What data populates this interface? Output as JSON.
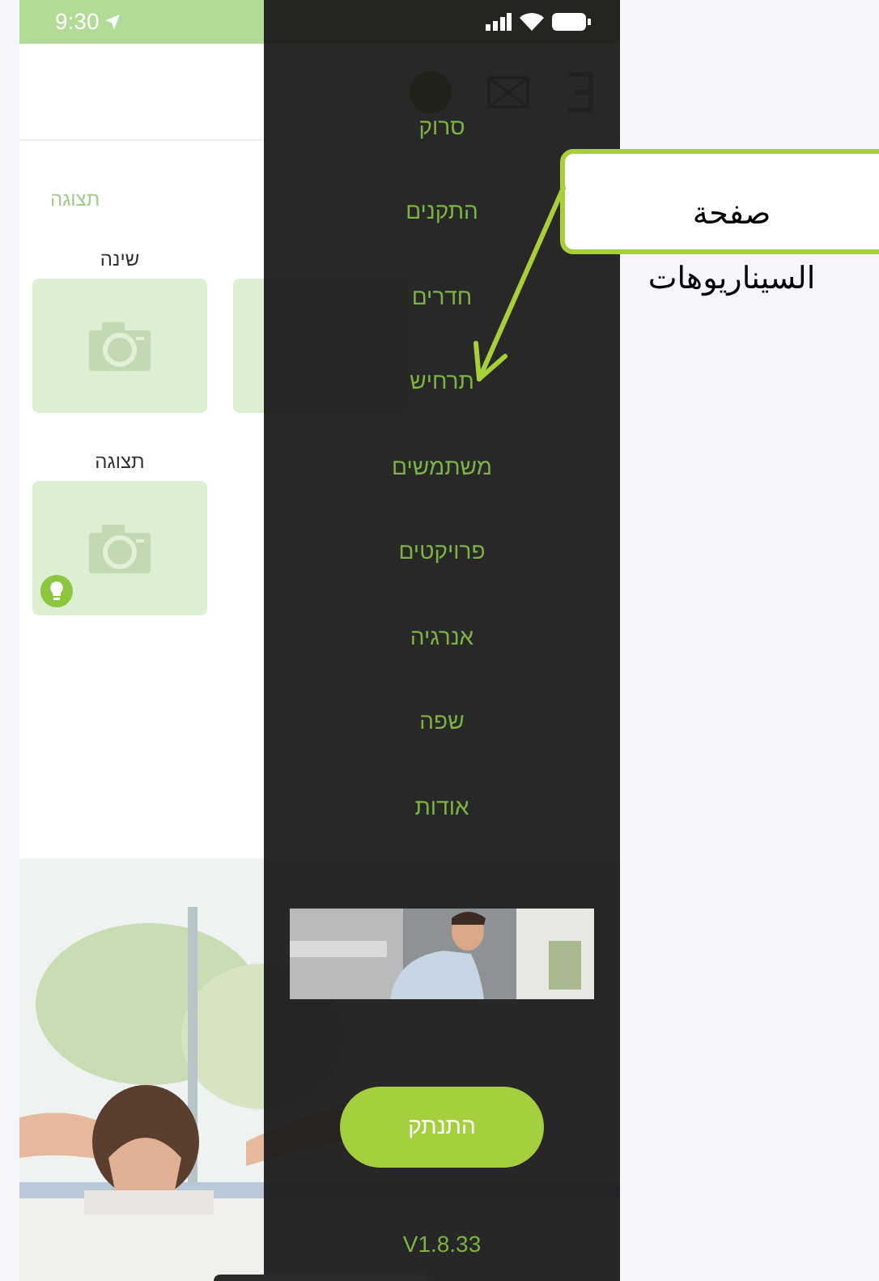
{
  "status_bar": {
    "time": "9:30"
  },
  "main_page": {
    "section_title": "תצוגה",
    "rooms": [
      {
        "kind": "covered"
      },
      {
        "kind": "room",
        "label": "שינה"
      }
    ],
    "second_section": {
      "title": "תצוגה",
      "rooms": [
        {
          "kind": "room",
          "has_light": true
        }
      ]
    }
  },
  "menu": {
    "items": [
      {
        "label": "סרוק",
        "selected": false
      },
      {
        "label": "התקנים",
        "selected": false
      },
      {
        "label": "חדרים",
        "selected": false
      },
      {
        "label": "תרחיש",
        "selected": false
      },
      {
        "label": "משתמשים",
        "selected": false
      },
      {
        "label": "פרויקטים",
        "selected": false
      },
      {
        "label": "אנרגיה",
        "selected": false
      },
      {
        "label": "שפה",
        "selected": false
      },
      {
        "label": "אודות",
        "selected": false
      }
    ],
    "logout_button": "התנתק",
    "version": "V1.8.33"
  },
  "annotation": {
    "text": "صفحة السيناريوهات"
  }
}
